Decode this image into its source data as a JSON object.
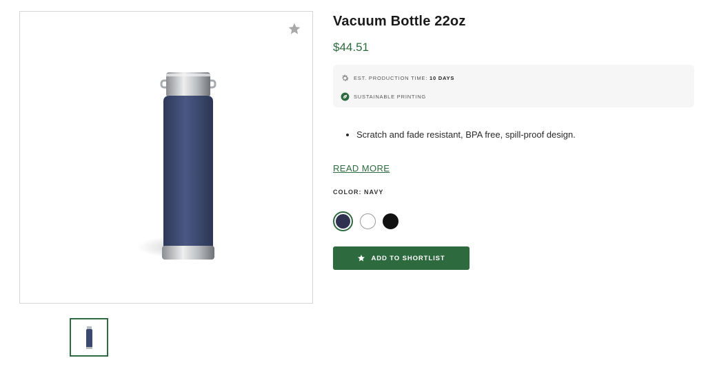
{
  "product": {
    "title": "Vacuum Bottle 22oz",
    "price": "$44.51",
    "image_alt": "navy vacuum bottle"
  },
  "info": {
    "production_label": "EST. PRODUCTION TIME:",
    "production_value": "10 DAYS",
    "sustainable_label": "SUSTAINABLE PRINTING"
  },
  "description": {
    "bullets": [
      "Scratch and fade resistant, BPA free, spill-proof design."
    ],
    "read_more": "READ MORE"
  },
  "color": {
    "label": "COLOR: NAVY",
    "options": [
      {
        "name": "navy",
        "hex": "#2f3350",
        "selected": true
      },
      {
        "name": "white",
        "hex": "#ffffff",
        "selected": false
      },
      {
        "name": "black",
        "hex": "#111111",
        "selected": false
      }
    ]
  },
  "actions": {
    "add_to_shortlist": "ADD TO SHORTLIST"
  },
  "icons": {
    "favorite": "star-icon",
    "production": "gear-icon",
    "sustainable": "leaf-icon",
    "button": "star-icon"
  },
  "theme": {
    "accent": "#2d6a3e",
    "product_color": "#3c4870"
  }
}
